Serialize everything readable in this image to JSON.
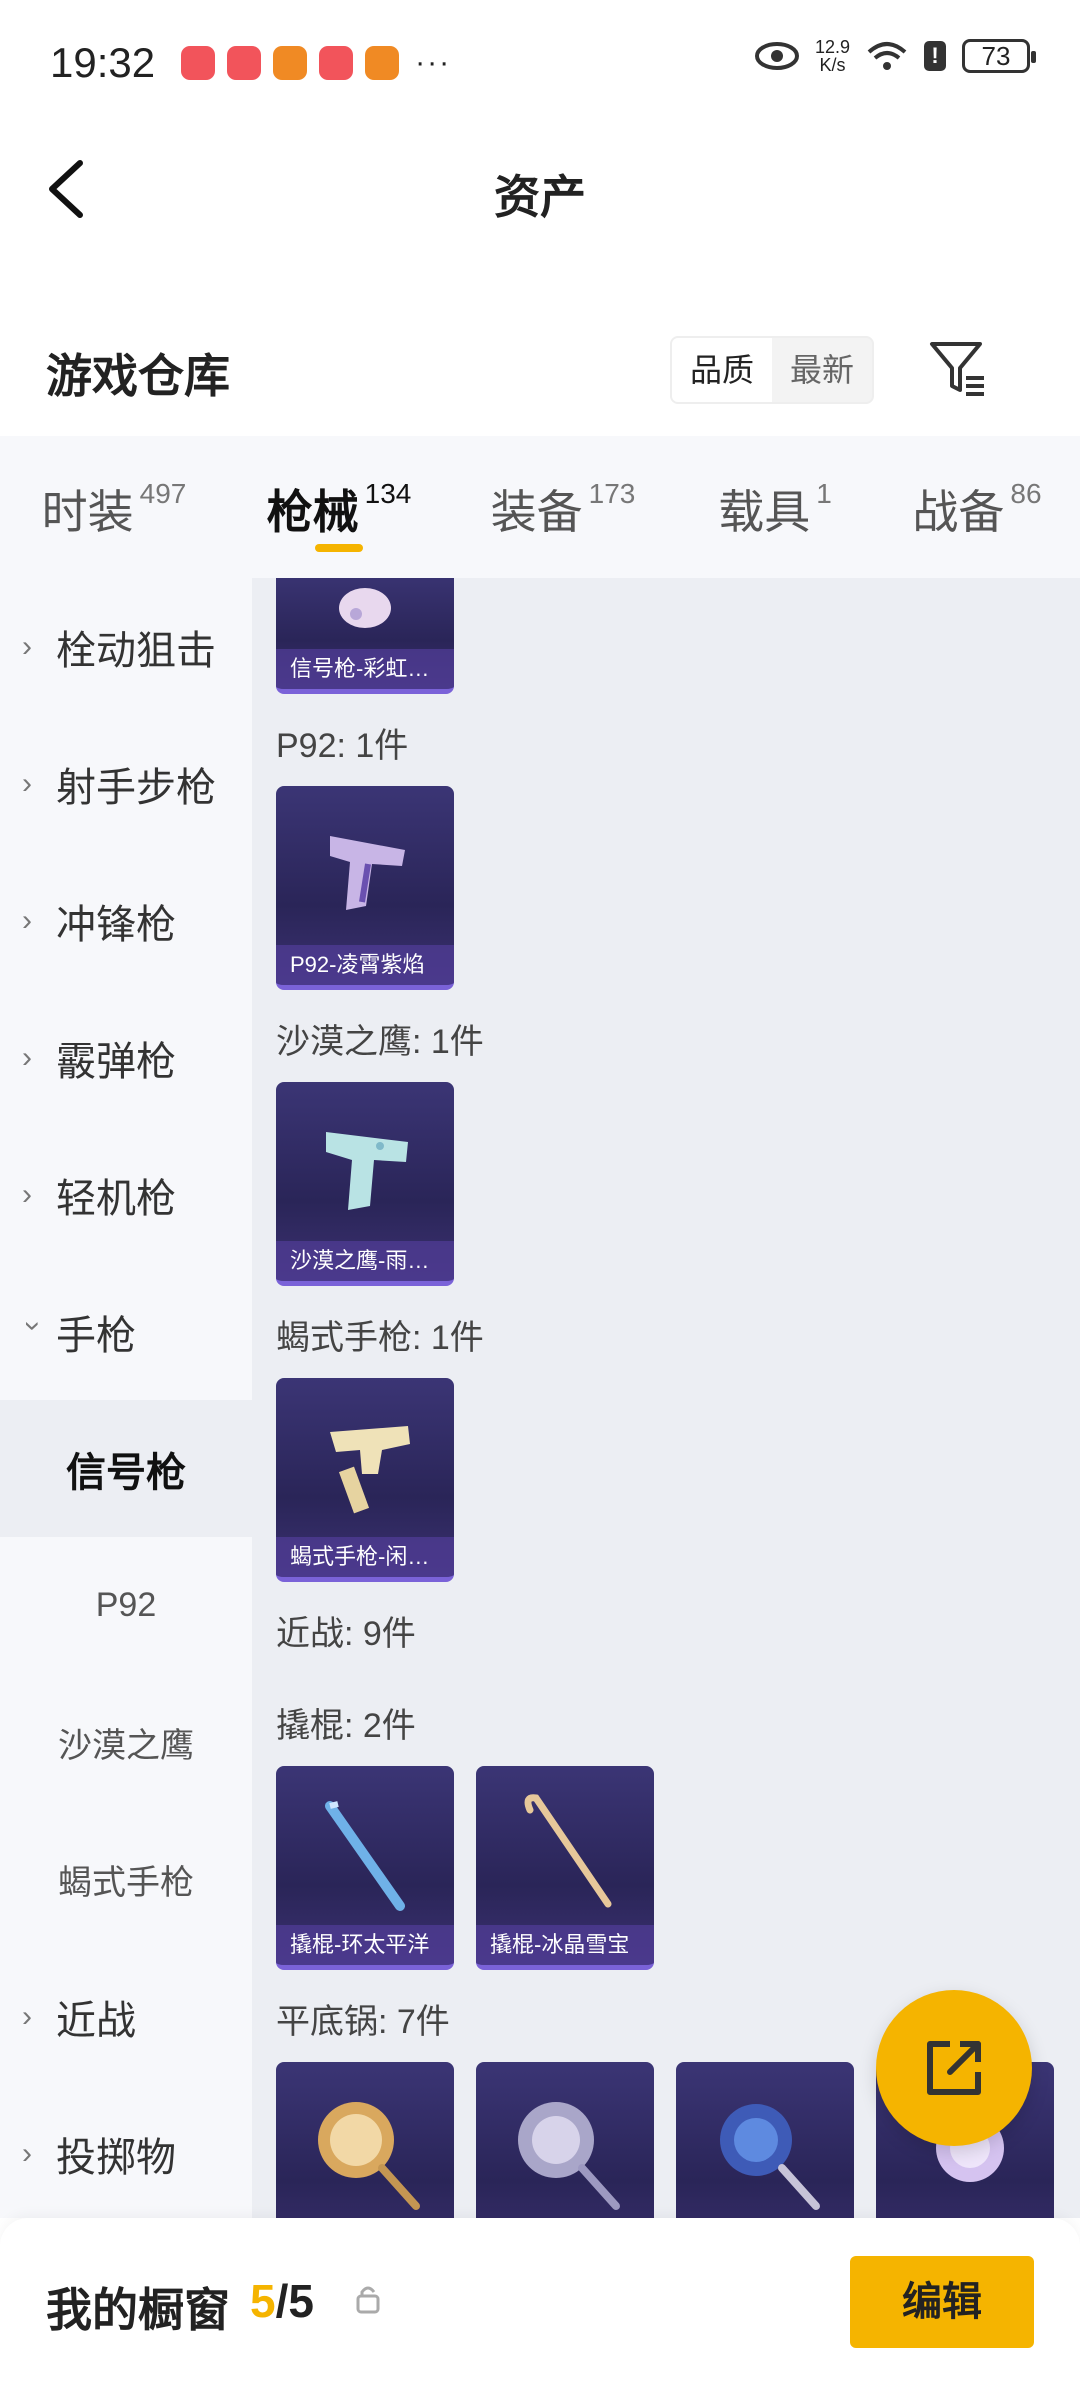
{
  "status": {
    "time": "19:32",
    "speed_top": "12.9",
    "speed_bottom": "K/s",
    "battery": "73",
    "dots": "···"
  },
  "header": {
    "title": "资产"
  },
  "warehouse": {
    "title": "游戏仓库",
    "sort_quality": "品质",
    "sort_latest": "最新"
  },
  "tabs": [
    {
      "label": "时装",
      "count": "497"
    },
    {
      "label": "枪械",
      "count": "134"
    },
    {
      "label": "装备",
      "count": "173"
    },
    {
      "label": "载具",
      "count": "1"
    },
    {
      "label": "战备",
      "count": "86"
    }
  ],
  "sidebar": [
    {
      "label": "栓动狙击"
    },
    {
      "label": "射手步枪"
    },
    {
      "label": "冲锋枪"
    },
    {
      "label": "霰弹枪"
    },
    {
      "label": "轻机枪"
    },
    {
      "label": "手枪"
    },
    {
      "label": "信号枪"
    },
    {
      "label": "P92"
    },
    {
      "label": "沙漠之鹰"
    },
    {
      "label": "蝎式手枪"
    },
    {
      "label": "近战"
    },
    {
      "label": "投掷物"
    }
  ],
  "content": {
    "items": [
      {
        "caption": "信号枪-彩虹…"
      },
      {
        "caption": "P92-凌霄紫焰"
      },
      {
        "caption": "沙漠之鹰-雨…"
      },
      {
        "caption": "蝎式手枪-闲…"
      },
      {
        "caption": "撬棍-环太平洋"
      },
      {
        "caption": "撬棍-冰晶雪宝"
      }
    ],
    "groups": [
      {
        "label": "P92: 1件"
      },
      {
        "label": "沙漠之鹰: 1件"
      },
      {
        "label": "蝎式手枪: 1件"
      },
      {
        "label": "近战: 9件"
      },
      {
        "label": "撬棍: 2件"
      },
      {
        "label": "平底锅: 7件"
      }
    ]
  },
  "bottom": {
    "title": "我的橱窗",
    "current": "5",
    "total": "/5",
    "edit_label": "编辑"
  },
  "colors": {
    "accent": "#f5b400",
    "card_bg": "#2a2558",
    "card_border": "#7a62d8"
  }
}
